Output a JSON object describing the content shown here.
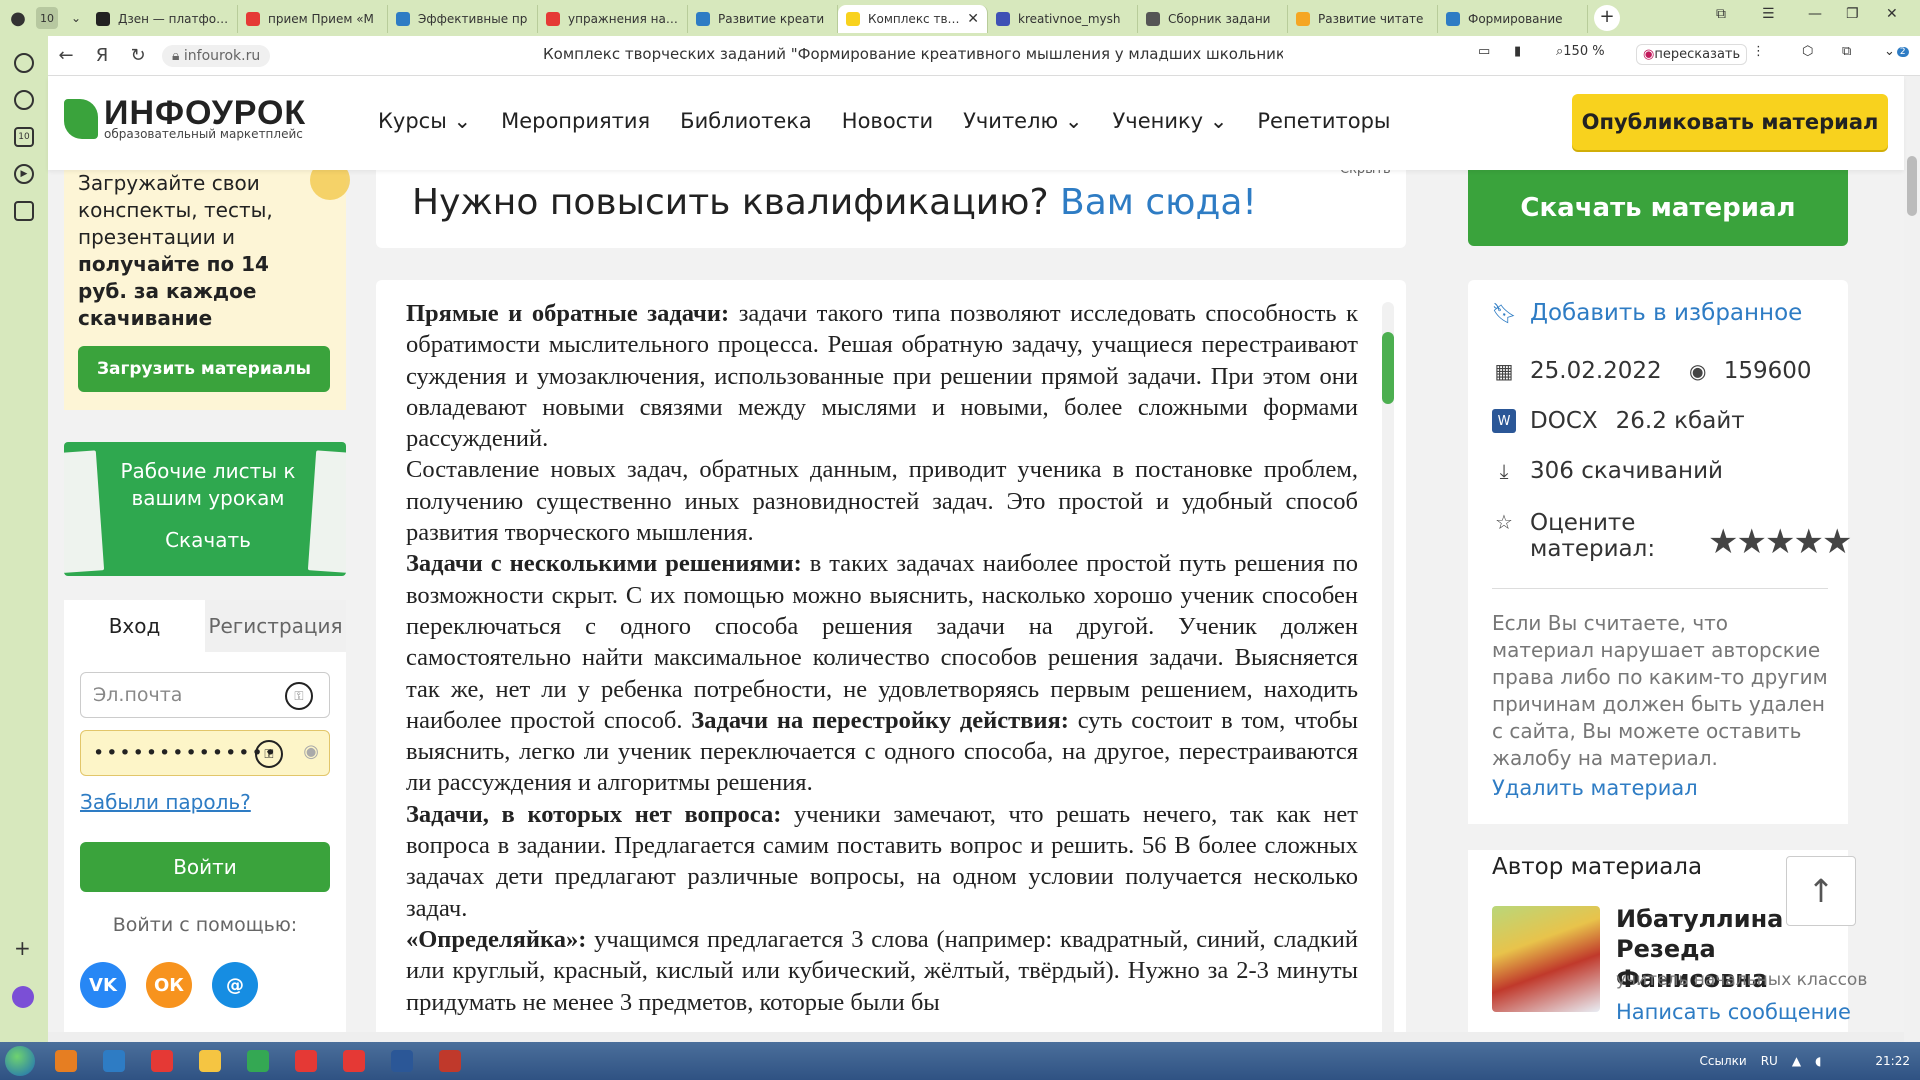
{
  "browser": {
    "tab_counter": "10",
    "tabs": [
      {
        "title": "Дзен — платформ",
        "color": "#222222"
      },
      {
        "title": "прием Прием «М",
        "color": "#e53935"
      },
      {
        "title": "Эффективные пр",
        "color": "#2e7cc4"
      },
      {
        "title": "упражнения напр",
        "color": "#e53935"
      },
      {
        "title": "Развитие креати",
        "color": "#2e7cc4"
      },
      {
        "title": "Комплекс твор",
        "color": "#f8d21e",
        "active": true
      },
      {
        "title": "kreativnoe_mysh",
        "color": "#3f51b5"
      },
      {
        "title": "Сборник задани",
        "color": "#555555"
      },
      {
        "title": "Развитие читате",
        "color": "#f5a623"
      },
      {
        "title": "Формирование",
        "color": "#2e7cc4"
      }
    ],
    "url_domain": "infourok.ru",
    "page_title": "Комплекс творческих заданий \"Формирование креативного мышления у младших школьников\"..",
    "zoom": "150 %",
    "retell_label": "пересказать",
    "extensions_badge": "2"
  },
  "site": {
    "logo_name": "ИНФОУРОК",
    "logo_sub": "образовательный маркетплейс",
    "nav": [
      "Курсы",
      "Мероприятия",
      "Библиотека",
      "Новости",
      "Учителю",
      "Ученику",
      "Репетиторы"
    ],
    "nav_dropdown": [
      true,
      false,
      false,
      false,
      true,
      true,
      false
    ],
    "publish_label": "Опубликовать материал"
  },
  "left": {
    "upload_line1": "Загружайте свои конспекты, тесты, презентации и",
    "upload_line2": "получайте по 14 руб. за каждое скачивание",
    "upload_button": "Загрузить материалы",
    "worksheets_title": "Рабочие листы к вашим урокам",
    "worksheets_button": "Скачать",
    "login_tab": "Вход",
    "register_tab": "Регистрация",
    "email_placeholder": "Эл.почта",
    "password_value": "••••••••••••••",
    "forgot": "Забыли пароль?",
    "login_button": "Войти",
    "login_with": "Войти с помощью:",
    "social": [
      {
        "name": "VK",
        "color": "#2787f5"
      },
      {
        "name": "ОК",
        "color": "#f7931e"
      },
      {
        "name": "@",
        "color": "#168de2"
      }
    ]
  },
  "banner": {
    "text": "Нужно повысить квалификацию? ",
    "link": "Вам сюда!",
    "hide": "Скрыть"
  },
  "document": {
    "paragraphs": [
      [
        {
          "b": "Прямые и обратные задачи:"
        },
        {
          "t": " задачи такого типа позволяют исследовать способность к обратимости мыслительного процесса. Решая обратную задачу, учащиеся перестраивают суждения и умозаключения, использованные при решении прямой задачи. При этом они овладевают новыми связями между мыслями и новыми, более сложными формами рассуждений."
        }
      ],
      [
        {
          "t": "Составление новых задач, обратных данным, приводит ученика в постановке проблем, получению существенно иных разновидностей задач. Это простой и удобный способ развития творческого мышления."
        }
      ],
      [
        {
          "b": "Задачи с несколькими решениями:"
        },
        {
          "t": " в таких задачах наиболее простой путь решения по возможности скрыт. С их помощью можно выяснить, насколько хорошо ученик способен переключаться с одного способа решения задачи на другой. Ученик должен самостоятельно найти максимальное количество способов решения задачи. Выясняется так же, нет ли у ребенка потребности, не удовлетворяясь первым решением, находить наиболее простой способ. "
        },
        {
          "b": "Задачи на перестройку действия:"
        },
        {
          "t": " суть состоит в том, чтобы выяснить, легко ли ученик переключается с одного способа, на другое, перестраиваются ли рассуждения и алгоритмы решения."
        }
      ],
      [
        {
          "b": "Задачи, в которых нет вопроса:"
        },
        {
          "t": " ученики замечают, что решать нечего, так как нет вопроса в задании. Предлагается самим поставить вопрос и решить. 56 В более сложных задачах дети предлагают различные вопросы, на одном условии получается несколько задач."
        }
      ],
      [
        {
          "b": " «Определяйка»:"
        },
        {
          "t": " учащимся предлагается 3 слова (например: квадратный, синий, сладкий или круглый, красный, кислый или кубический, жёлтый, твёрдый). Нужно за 2-3 минуты придумать не менее 3 предметов, которые были бы"
        }
      ]
    ]
  },
  "right": {
    "download_button": "Скачать материал",
    "favorite": "Добавить в избранное",
    "date": "25.02.2022",
    "views": "159600",
    "format": "DOCX",
    "size": "26.2 кбайт",
    "downloads": "306 скачиваний",
    "rate_label": "Оцените материал:",
    "rating_stars": 5,
    "complaint": "Если Вы считаете, что материал нарушает авторские права либо по каким-то другим причинам должен быть удален с сайта, Вы можете оставить жалобу на материал.",
    "delete": "Удалить материал",
    "author_heading": "Автор материала",
    "author_name": "Ибатуллина Резеда Фанисовна",
    "author_role": "учитель начальных классов",
    "write_message": "Написать сообщение"
  },
  "taskbar": {
    "apps": [
      "#e67e22",
      "#2e7cc4",
      "#e53935",
      "#f5c542",
      "#34a853",
      "#e53935",
      "#e53935",
      "#2b5797",
      "#c0392b"
    ],
    "links_label": "Ссылки",
    "lang": "RU",
    "time": "21:22"
  }
}
